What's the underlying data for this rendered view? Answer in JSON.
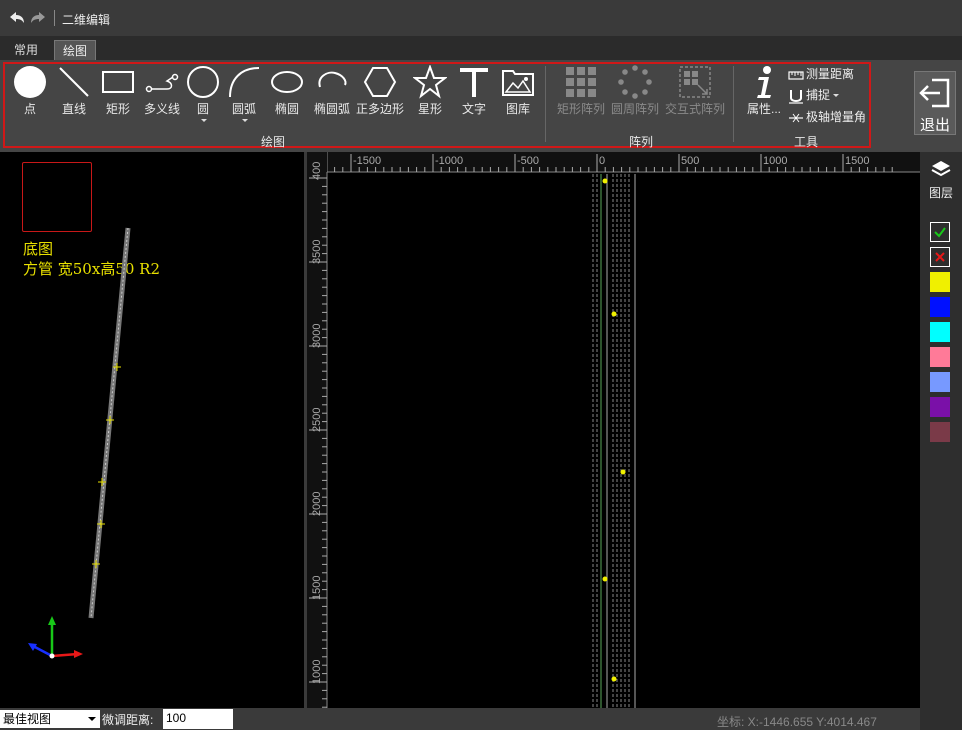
{
  "titlebar": {
    "title": "二维编辑"
  },
  "tabs": [
    {
      "label": "常用"
    },
    {
      "label": "绘图"
    }
  ],
  "ribbon": {
    "draw_tools": [
      {
        "label": "点"
      },
      {
        "label": "直线"
      },
      {
        "label": "矩形"
      },
      {
        "label": "多义线"
      },
      {
        "label": "圆"
      },
      {
        "label": "圆弧"
      },
      {
        "label": "椭圆"
      },
      {
        "label": "椭圆弧"
      },
      {
        "label": "正多边形"
      },
      {
        "label": "星形"
      },
      {
        "label": "文字"
      },
      {
        "label": "图库"
      }
    ],
    "draw_group_label": "绘图",
    "array_tools": [
      {
        "label": "矩形阵列"
      },
      {
        "label": "圆周阵列"
      },
      {
        "label": "交互式阵列"
      }
    ],
    "array_group_label": "阵列",
    "properties_label": "属性...",
    "measure_label": "测量距离",
    "snap_label": "捕捉",
    "polar_label": "极轴增量角",
    "tools_group_label": "工具",
    "exit_label": "退出"
  },
  "left_view": {
    "label_line1": "底图",
    "label_line2": "方管 宽50x高50 R2"
  },
  "ruler": {
    "top_ticks": [
      "-1500",
      "-1000",
      "-500",
      "0",
      "500",
      "1000",
      "1500"
    ],
    "left_ticks": [
      "400",
      "3500",
      "3000",
      "2500",
      "2000",
      "1500",
      "1000"
    ]
  },
  "layers": {
    "title": "图层",
    "swatches": [
      "#f0f000",
      "#0010ff",
      "#00ffff",
      "#ff7a98",
      "#7799ff",
      "#7a10a8",
      "#7a3a48"
    ]
  },
  "statusbar": {
    "view_combo": "最佳视图",
    "fine_tune_label": "微调距离:",
    "fine_tune_value": "100",
    "coords": "坐标: X:-1446.655 Y:4014.467"
  }
}
